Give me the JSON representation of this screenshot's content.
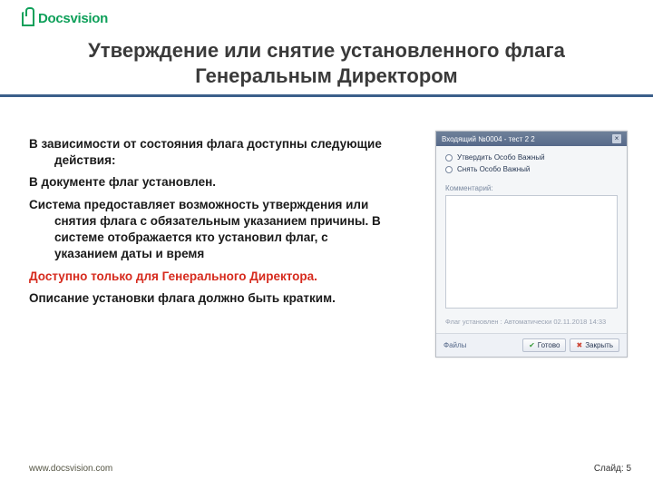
{
  "logo": {
    "text": "Docsvision"
  },
  "title": {
    "line1": "Утверждение или снятие  установленного флага",
    "line2": "Генеральным Директором"
  },
  "content": {
    "p1": "В зависимости от состояния флага доступны следующие действия:",
    "p2": "В документе флаг  установлен.",
    "p3": "Система предоставляет возможность утверждения или снятия флага с обязательным указанием причины. В системе отображается кто установил флаг, с указанием даты и время",
    "p4": "Доступно только для Генерального Директора.",
    "p5": "Описание установки флага должно быть кратким."
  },
  "dialog": {
    "title": "Входящий №0004 - тест 2 2",
    "radio1": "Утвердить Особо Важный",
    "radio2": "Снять Особо Важный",
    "comment_label": "Комментарий:",
    "meta": "Флаг установлен : Автоматически 02.11.2018 14:33",
    "footer_left": "Файлы",
    "btn_ok": "Готово",
    "btn_cancel": "Закрыть"
  },
  "footer": {
    "url": "www.docsvision.com",
    "slide_label": "Слайд:",
    "slide_num": "5"
  }
}
